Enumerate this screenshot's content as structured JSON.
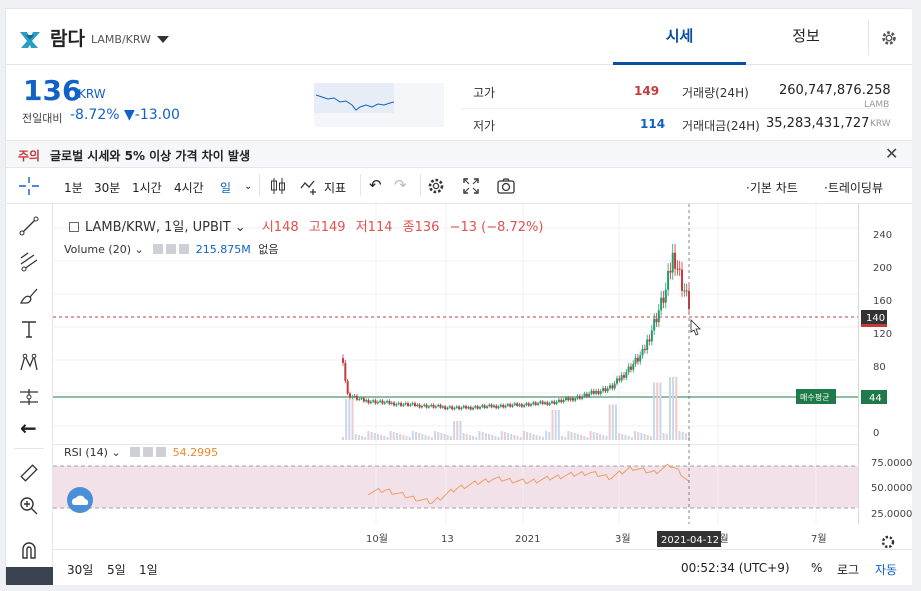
{
  "header": {
    "coin_name": "람다",
    "pair": "LAMB/KRW",
    "tabs": [
      {
        "label": "시세"
      },
      {
        "label": "정보"
      }
    ]
  },
  "price_panel": {
    "price": "136",
    "currency": "KRW",
    "change_label": "전일대비",
    "change_pct": "-8.72%",
    "change_abs": "▼-13.00",
    "high_label": "고가",
    "high_value": "149",
    "low_label": "저가",
    "low_value": "114",
    "volume_label": "거래량(24H)",
    "volume_value": "260,747,876.258",
    "volume_unit": "LAMB",
    "amount_label": "거래대금(24H)",
    "amount_value": "35,283,431,727",
    "amount_unit": "KRW"
  },
  "notice": {
    "tag": "주의",
    "text": "글로벌 시세와 5% 이상 가격 차이 발생"
  },
  "toolbar": {
    "intervals": [
      "1분",
      "30분",
      "1시간",
      "4시간",
      "일"
    ],
    "indicator_label": "지표",
    "basic_chart_label": "·기본 차트",
    "trading_view_label": "·트레이딩뷰"
  },
  "legend": {
    "symbol": "LAMB/KRW, 1일, UPBIT",
    "open_label": "시",
    "open": "148",
    "high_label": "고",
    "high": "149",
    "low_label": "저",
    "low": "114",
    "close_label": "종",
    "close": "136",
    "change": "−13 (−8.72%)",
    "volume_label": "Volume (20)",
    "volume_value": "215.875M",
    "volume_extra": "없음",
    "rsi_label": "RSI (14)",
    "rsi_value": "54.2995"
  },
  "chart": {
    "price_ticks": [
      "240",
      "200",
      "160",
      "120",
      "80",
      "40",
      "0"
    ],
    "rsi_ticks": [
      "75.0000",
      "50.0000",
      "25.0000"
    ],
    "time_ticks": [
      "10월",
      "13",
      "2021",
      "3월",
      "5월",
      "7월"
    ],
    "crosshair_date": "2021-04-12",
    "crosshair_price": "140",
    "last_price_tag": "44",
    "avg_buy_label": "매수평균"
  },
  "chart_data": {
    "type": "candlestick",
    "title": "LAMB/KRW, 1일, UPBIT",
    "ylim": [
      0,
      250
    ],
    "rsi_ylim": [
      0,
      100
    ],
    "price_path": [
      [
        0,
        80
      ],
      [
        0.01,
        42
      ],
      [
        0.05,
        36
      ],
      [
        0.15,
        32
      ],
      [
        0.3,
        28
      ],
      [
        0.45,
        31
      ],
      [
        0.55,
        34
      ],
      [
        0.62,
        40
      ],
      [
        0.7,
        50
      ],
      [
        0.78,
        85
      ],
      [
        0.84,
        150
      ],
      [
        0.86,
        190
      ],
      [
        0.88,
        160
      ],
      [
        0.9,
        136
      ]
    ],
    "rsi_path": [
      [
        0,
        38
      ],
      [
        0.05,
        42
      ],
      [
        0.12,
        30
      ],
      [
        0.18,
        22
      ],
      [
        0.25,
        45
      ],
      [
        0.35,
        60
      ],
      [
        0.45,
        55
      ],
      [
        0.55,
        65
      ],
      [
        0.62,
        70
      ],
      [
        0.68,
        62
      ],
      [
        0.74,
        78
      ],
      [
        0.8,
        70
      ],
      [
        0.85,
        82
      ],
      [
        0.88,
        68
      ],
      [
        0.9,
        54
      ]
    ],
    "volume_spikes": [
      [
        0.02,
        0.6
      ],
      [
        0.3,
        0.2
      ],
      [
        0.55,
        0.4
      ],
      [
        0.7,
        0.5
      ],
      [
        0.82,
        0.9
      ],
      [
        0.86,
        1.0
      ]
    ],
    "avg_buy_price": 44,
    "crosshair_price": 140
  },
  "bottombar": {
    "ranges": [
      "30일",
      "5일",
      "1일"
    ],
    "clock": "00:52:34 (UTC+9)",
    "pct_label": "%",
    "log_label": "로그",
    "auto_label": "자동"
  }
}
